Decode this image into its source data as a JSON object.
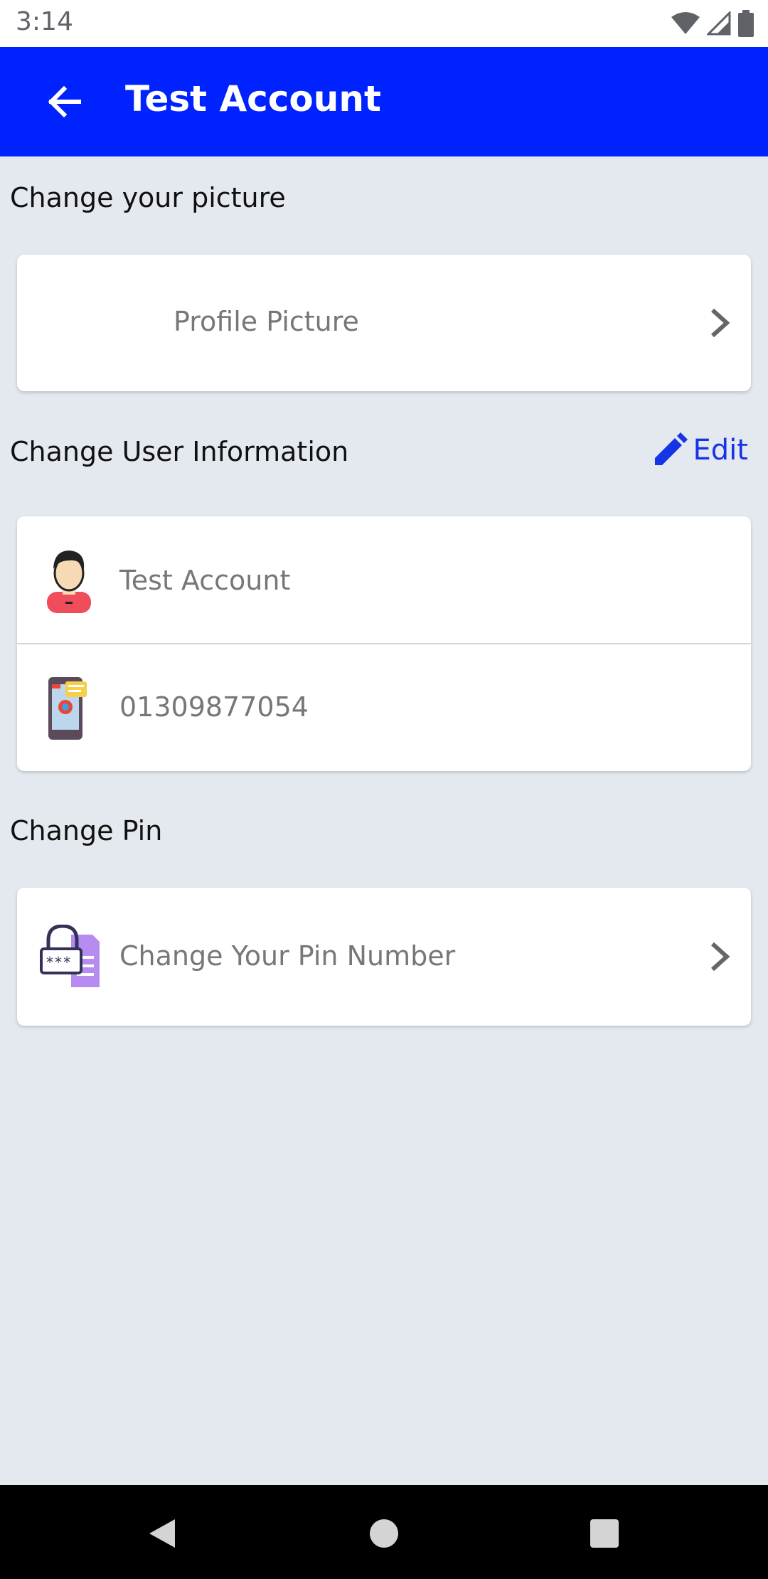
{
  "status_bar": {
    "time": "3:14",
    "icons": [
      "wifi-icon",
      "signal-icon",
      "battery-icon"
    ]
  },
  "app_bar": {
    "title": "Test Account",
    "back_icon": "arrow-left-icon",
    "background_color": "#0022ff"
  },
  "sections": {
    "picture": {
      "title": "Change your picture",
      "item_label": "Profile Picture"
    },
    "user_info": {
      "title": "Change User Information",
      "edit_label": "Edit",
      "name_value": "Test Account",
      "phone_value": "01309877054"
    },
    "pin": {
      "title": "Change Pin",
      "item_label": "Change Your Pin Number"
    }
  },
  "colors": {
    "accent": "#0022ff",
    "page_background": "#e4e8ef",
    "edit_color": "#1534e6"
  },
  "nav_bar": {
    "items": [
      "back-triangle-icon",
      "home-circle-icon",
      "recents-square-icon"
    ]
  }
}
